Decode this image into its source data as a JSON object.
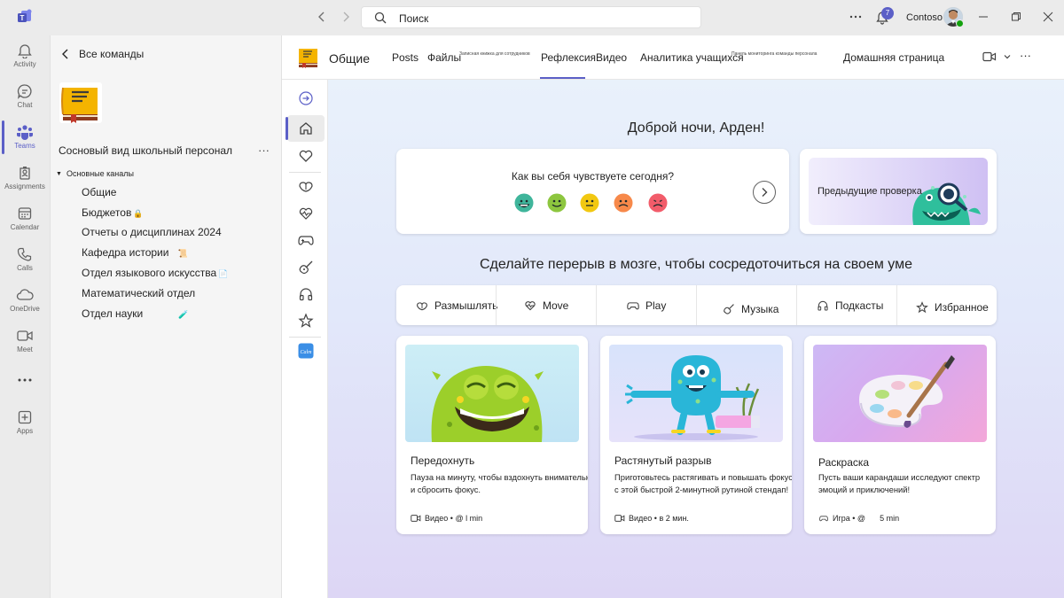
{
  "titlebar": {
    "search_placeholder": "Поиск",
    "notification_count": "7",
    "org_name": "Contoso"
  },
  "rail": {
    "items": [
      {
        "label": "Activity",
        "icon": "bell-icon"
      },
      {
        "label": "Chat",
        "icon": "chat-icon"
      },
      {
        "label": "Teams",
        "icon": "teams-icon"
      },
      {
        "label": "Assignments",
        "icon": "assignments-icon"
      },
      {
        "label": "Calendar",
        "icon": "calendar-icon"
      },
      {
        "label": "Calls",
        "icon": "phone-icon"
      },
      {
        "label": "OneDrive",
        "icon": "cloud-icon"
      },
      {
        "label": "Meet",
        "icon": "camera-icon"
      },
      {
        "label": "...",
        "icon": "more-icon"
      },
      {
        "label": "Apps",
        "icon": "apps-icon"
      }
    ],
    "active": "Teams"
  },
  "team_panel": {
    "back_label": "Все команды",
    "team_name": "Сосновый вид школьный персонал",
    "more": "···",
    "channels_heading": "Основные каналы",
    "channels": [
      {
        "name": "Общие",
        "suffix": ""
      },
      {
        "name": "Бюджетов",
        "suffix": "🔒"
      },
      {
        "name": "Отчеты о дисциплинах 2024",
        "suffix": ""
      },
      {
        "name": "Кафедра истории",
        "suffix": "📜"
      },
      {
        "name": "Отдел языкового искусства",
        "suffix": "📄"
      },
      {
        "name": "Математический отдел",
        "suffix": ""
      },
      {
        "name": "Отдел науки",
        "suffix": "🧪"
      }
    ]
  },
  "tabbar": {
    "channel_title": "Общие",
    "tabs": [
      {
        "label": "Posts"
      },
      {
        "label": "Файлы"
      },
      {
        "label": "Записная книжка для сотрудников"
      },
      {
        "label": "Рефлексия"
      },
      {
        "label": "Видео"
      },
      {
        "label": "Аналитика учащихся"
      },
      {
        "label": "Панель мониторинга команды персонала"
      },
      {
        "label": "Домашняя страница"
      }
    ],
    "active_tab": "Рефлексия",
    "more": "···"
  },
  "reflect": {
    "greeting": "Доброй ночи, Арден!",
    "mood_question": "Как вы себя чувствуете сегодня?",
    "moods": [
      {
        "name": "great",
        "color": "#3fb59b"
      },
      {
        "name": "good",
        "color": "#8dc63f"
      },
      {
        "name": "okay",
        "color": "#f2c811"
      },
      {
        "name": "bad",
        "color": "#f7894a"
      },
      {
        "name": "terrible",
        "color": "#f25c6a"
      }
    ],
    "previous_checkins": "Предыдущие проверка",
    "brain_break_title": "Сделайте перерыв в мозге, чтобы сосредоточиться на своем уме",
    "categories": [
      {
        "label": "Размышлять",
        "icon": "reflect-icon"
      },
      {
        "label": "Move",
        "icon": "heartbeat-icon"
      },
      {
        "label": "Play",
        "icon": "gamepad-icon"
      },
      {
        "label": "Музыка",
        "icon": "guitar-icon"
      },
      {
        "label": "Подкасты",
        "icon": "headphones-icon"
      },
      {
        "label": "Избранное",
        "icon": "star-icon"
      }
    ],
    "cards": [
      {
        "title": "Передохнуть",
        "desc1": "Пауза на минуту, чтобы вздохнуть внимательно",
        "desc2": "и сбросить фокус.",
        "meta": "Видео • @ l min",
        "meta_icon": "video-icon"
      },
      {
        "title": "Растянутый разрыв",
        "desc1": "Приготовьтесь растягивать и повышать фокус",
        "desc2": "с этой быстрой 2-минутной рутиной стендап!",
        "meta": "Видео • в 2 мин.",
        "meta_icon": "video-icon"
      },
      {
        "title": "Раскраска",
        "desc1": "Пусть ваши карандаши исследуют спектр",
        "desc2": "эмоций и приключений!",
        "meta": "Игра • @ ",
        "meta2": "5 min",
        "meta_icon": "gamepad-icon"
      }
    ]
  },
  "colors": {
    "accent": "#5b5fc7",
    "rail_bg": "#ebebeb",
    "panel_bg": "#f5f5f5"
  }
}
